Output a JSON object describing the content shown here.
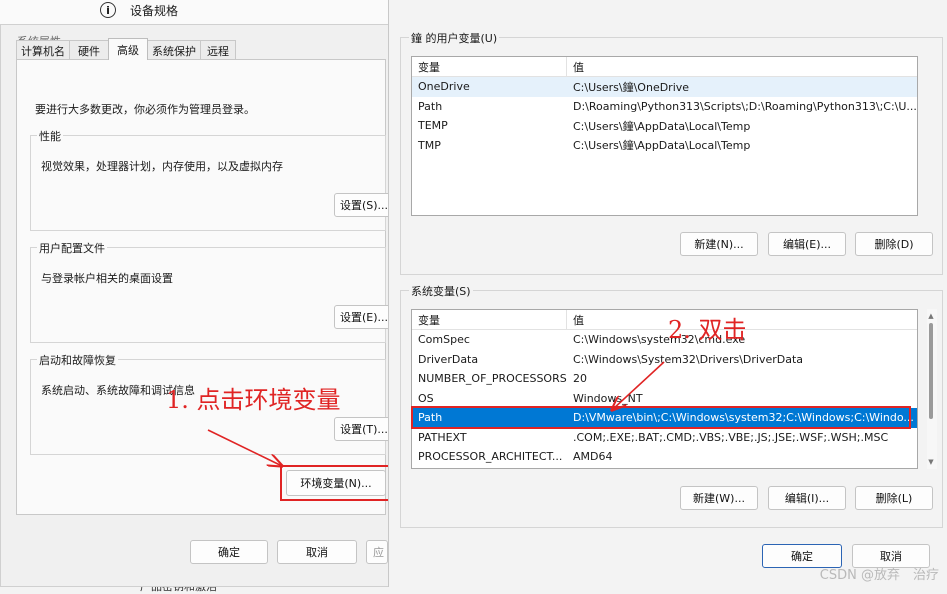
{
  "background": {
    "settings_item": "设备规格",
    "settings_icon": "info-icon",
    "bottom_peek": "产品密钥和激活"
  },
  "system_properties": {
    "title": "系统属性",
    "tabs": [
      "计算机名",
      "硬件",
      "高级",
      "系统保护",
      "远程"
    ],
    "active_tab": "高级",
    "admin_note": "要进行大多数更改，你必须作为管理员登录。",
    "performance": {
      "title": "性能",
      "desc": "视觉效果，处理器计划，内存使用，以及虚拟内存",
      "button": "设置(S)..."
    },
    "user_profiles": {
      "title": "用户配置文件",
      "desc": "与登录帐户相关的桌面设置",
      "button": "设置(E)..."
    },
    "startup_recovery": {
      "title": "启动和故障恢复",
      "desc": "系统启动、系统故障和调试信息",
      "button": "设置(T)..."
    },
    "env_button": "环境变量(N)...",
    "ok": "确定",
    "cancel": "取消",
    "apply": "应"
  },
  "env_dialog": {
    "user_vars": {
      "title": "鐘 的用户变量(U)",
      "columns": [
        "变量",
        "值"
      ],
      "rows": [
        {
          "name": "OneDrive",
          "value": "C:\\Users\\鐘\\OneDrive"
        },
        {
          "name": "Path",
          "value": "D:\\Roaming\\Python313\\Scripts\\;D:\\Roaming\\Python313\\;C:\\U..."
        },
        {
          "name": "TEMP",
          "value": "C:\\Users\\鐘\\AppData\\Local\\Temp"
        },
        {
          "name": "TMP",
          "value": "C:\\Users\\鐘\\AppData\\Local\\Temp"
        }
      ],
      "buttons": {
        "new": "新建(N)...",
        "edit": "编辑(E)...",
        "delete": "删除(D)"
      }
    },
    "system_vars": {
      "title": "系统变量(S)",
      "columns": [
        "变量",
        "值"
      ],
      "rows": [
        {
          "name": "ComSpec",
          "value": "C:\\Windows\\system32\\cmd.exe"
        },
        {
          "name": "DriverData",
          "value": "C:\\Windows\\System32\\Drivers\\DriverData"
        },
        {
          "name": "NUMBER_OF_PROCESSORS",
          "value": "20"
        },
        {
          "name": "OS",
          "value": "Windows_NT"
        },
        {
          "name": "Path",
          "value": "D:\\VMware\\bin\\;C:\\Windows\\system32;C:\\Windows;C:\\Windo..."
        },
        {
          "name": "PATHEXT",
          "value": ".COM;.EXE;.BAT;.CMD;.VBS;.VBE;.JS;.JSE;.WSF;.WSH;.MSC"
        },
        {
          "name": "PROCESSOR_ARCHITECT...",
          "value": "AMD64"
        }
      ],
      "selected_row": 4,
      "buttons": {
        "new": "新建(W)...",
        "edit": "编辑(I)...",
        "delete": "删除(L)"
      }
    },
    "ok": "确定",
    "cancel": "取消"
  },
  "annotations": {
    "step1": "1. 点击环境变量",
    "step2": "2. 双击",
    "color": "#e02424"
  },
  "watermark": "CSDN @放弃　治疗"
}
